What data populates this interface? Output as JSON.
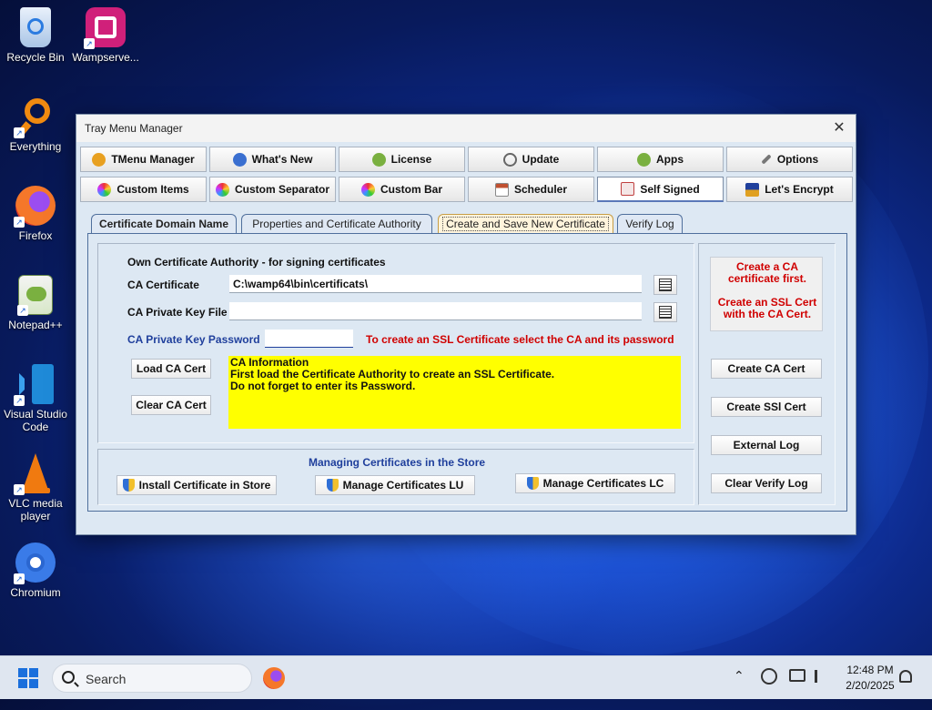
{
  "desktop": {
    "icons": [
      {
        "label": "Recycle Bin",
        "icon": "recycle-bin-icon"
      },
      {
        "label": "Wampserve...",
        "icon": "wampserver-icon"
      },
      {
        "label": "Everything",
        "icon": "everything-search-icon"
      },
      {
        "label": "Firefox",
        "icon": "firefox-icon"
      },
      {
        "label": "Notepad++",
        "icon": "notepadpp-icon"
      },
      {
        "label": "Visual Studio Code",
        "icon": "vscode-icon"
      },
      {
        "label": "VLC media player",
        "icon": "vlc-icon"
      },
      {
        "label": "Chromium",
        "icon": "chromium-icon"
      }
    ]
  },
  "window": {
    "title": "Tray Menu Manager",
    "close_glyph": "✕",
    "toolbar_row1": [
      {
        "label": "TMenu Manager",
        "icon": "info-icon",
        "color": "#e8a020"
      },
      {
        "label": "What's New",
        "icon": "globe-icon",
        "color": "#3a6fd0"
      },
      {
        "label": "License",
        "icon": "green-circle-icon",
        "color": "#7ab040"
      },
      {
        "label": "Update",
        "icon": "refresh-clock-icon",
        "color": "#666666"
      },
      {
        "label": "Apps",
        "icon": "apps-icon",
        "color": "#7ab040"
      },
      {
        "label": "Options",
        "icon": "wrench-icon",
        "color": "#555555"
      }
    ],
    "toolbar_row2": [
      {
        "label": "Custom Items",
        "icon": "color-wheel-icon",
        "color": "#d04090"
      },
      {
        "label": "Custom Separator",
        "icon": "color-wheel-icon",
        "color": "#d04090"
      },
      {
        "label": "Custom Bar",
        "icon": "color-wheel-icon",
        "color": "#d04090"
      },
      {
        "label": "Scheduler",
        "icon": "calendar-icon",
        "color": "#c05030"
      },
      {
        "label": "Self Signed",
        "icon": "certificate-icon",
        "color": "#c04040"
      },
      {
        "label": "Let's Encrypt",
        "icon": "lock-certificate-icon",
        "color": "#e0a020"
      }
    ],
    "tabs": [
      {
        "label": "Certificate Domain Name"
      },
      {
        "label": "Properties and Certificate Authority"
      },
      {
        "label": "Create and Save New Certificate"
      },
      {
        "label": "Verify Log"
      }
    ],
    "panel": {
      "section_title": "Own Certificate Authority - for signing certificates",
      "ca_certificate_label": "CA Certificate",
      "ca_certificate_value": "C:\\wamp64\\bin\\certificats\\",
      "ca_private_key_label": "CA Private Key File",
      "ca_private_key_value": "",
      "ca_password_label": "CA Private Key Password",
      "ca_password_value": "",
      "ssl_hint": "To create an SSL Certificate select the CA and its password",
      "load_ca_label": "Load CA Cert",
      "clear_ca_label": "Clear CA Cert",
      "info_lines": [
        "CA Information",
        "First load the Certificate Authority to create an SSL Certificate.",
        "Do not forget to enter its Password."
      ],
      "store_title": "Managing Certificates in the Store",
      "install_store_label": "Install Certificate in Store",
      "manage_lu_label": "Manage Certificates LU",
      "manage_lc_label": "Manage Certificates LC",
      "notice_line1": "Create a CA",
      "notice_line2": "certificate first.",
      "notice_line3": "Create an SSL Cert",
      "notice_line4": "with the CA Cert.",
      "create_ca_label": "Create CA Cert",
      "create_ssl_label": "Create SSl Cert",
      "external_log_label": "External Log",
      "clear_verify_label": "Clear Verify Log"
    }
  },
  "taskbar": {
    "search_placeholder": "Search",
    "time": "12:48 PM",
    "date": "2/20/2025"
  },
  "colors": {
    "info_box": "#ffff00",
    "alert_red": "#d00000",
    "password_label_blue": "#1f3f9c",
    "store_title_blue": "#1f3f9c"
  }
}
